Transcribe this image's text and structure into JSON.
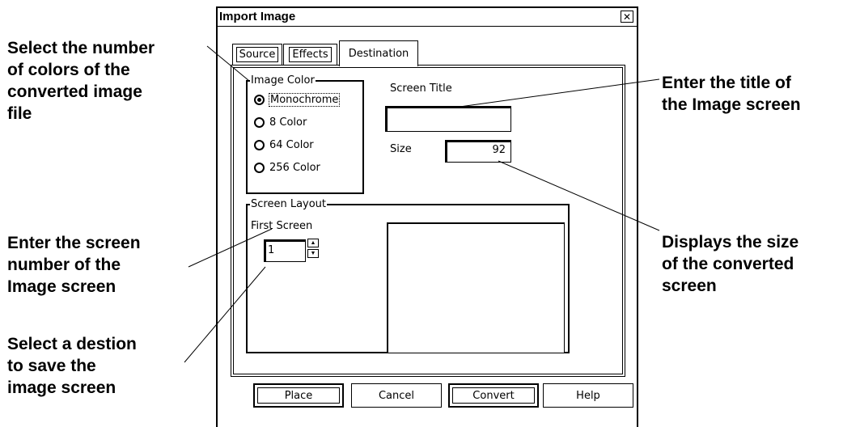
{
  "dialog": {
    "title": "Import Image",
    "close_glyph": "✕"
  },
  "tabs": [
    {
      "label": "Source"
    },
    {
      "label": "Effects"
    },
    {
      "label": "Destination",
      "active": true
    }
  ],
  "image_color": {
    "legend": "Image Color",
    "options": [
      {
        "label": "Monochrome",
        "checked": true
      },
      {
        "label": "8 Color",
        "checked": false
      },
      {
        "label": "64 Color",
        "checked": false
      },
      {
        "label": "256 Color",
        "checked": false
      }
    ]
  },
  "screen_title": {
    "label": "Screen Title",
    "value": ""
  },
  "size": {
    "label": "Size",
    "value": "92"
  },
  "screen_layout": {
    "legend": "Screen Layout",
    "first_screen_label": "First Screen",
    "first_screen_value": "1"
  },
  "buttons": {
    "place": "Place",
    "cancel": "Cancel",
    "convert": "Convert",
    "help": "Help"
  },
  "callouts": {
    "colors": [
      "Select the number",
      "of colors of the",
      "converted image",
      "file"
    ],
    "screen_number": [
      "Enter the screen",
      "number of the",
      "Image screen"
    ],
    "destination": [
      "Select a destion",
      "to save the",
      "image screen"
    ],
    "title": [
      "Enter the title of",
      "the Image screen"
    ],
    "size": [
      "Displays the size",
      "of the converted",
      "screen"
    ]
  }
}
